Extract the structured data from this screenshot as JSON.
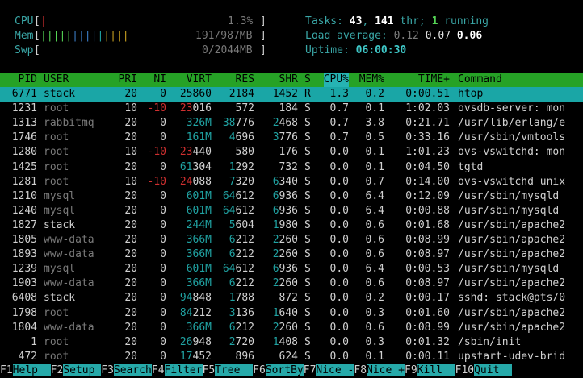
{
  "meters": {
    "cpu": {
      "label": "CPU",
      "bar": "|",
      "value": "1.3%"
    },
    "mem": {
      "label": "Mem",
      "bar": "||||||||||||||",
      "value": "191/987MB"
    },
    "swp": {
      "label": "Swp",
      "bar": "",
      "value": "0/2044MB"
    }
  },
  "summary": {
    "tasks_label": "Tasks: ",
    "tasks": "43",
    "thr": "141",
    "thr_label": " thr; ",
    "running": "1",
    "running_label": " running",
    "load_label": "Load average: ",
    "load1": "0.12",
    "load5": "0.07",
    "load15": "0.06",
    "uptime_label": "Uptime: ",
    "uptime": "06:00:30"
  },
  "columns": [
    "PID",
    "USER",
    "PRI",
    "NI",
    "VIRT",
    "RES",
    "SHR",
    "S",
    "CPU%",
    "MEM%",
    "TIME+",
    "Command"
  ],
  "processes": [
    {
      "pid": "6771",
      "user": "stack",
      "pri": "20",
      "ni": "0",
      "virt": "25860",
      "res": "2184",
      "shr": "1452",
      "s": "R",
      "cpu": "1.3",
      "mem": "0.2",
      "time": "0:00.51",
      "cmd": "htop",
      "selected": true
    },
    {
      "pid": "1231",
      "user": "root",
      "pri": "10",
      "ni": "-10",
      "virt": "23016",
      "res": "572",
      "shr": "184",
      "s": "S",
      "cpu": "0.7",
      "mem": "0.1",
      "time": "1:02.03",
      "cmd": "ovsdb-server: mon"
    },
    {
      "pid": "1313",
      "user": "rabbitmq",
      "pri": "20",
      "ni": "0",
      "virt": "326M",
      "res": "38776",
      "shr": "2468",
      "s": "S",
      "cpu": "0.7",
      "mem": "3.8",
      "time": "0:21.71",
      "cmd": "/usr/lib/erlang/e"
    },
    {
      "pid": "1746",
      "user": "root",
      "pri": "20",
      "ni": "0",
      "virt": "161M",
      "res": "4696",
      "shr": "3776",
      "s": "S",
      "cpu": "0.7",
      "mem": "0.5",
      "time": "0:33.16",
      "cmd": "/usr/sbin/vmtools"
    },
    {
      "pid": "1280",
      "user": "root",
      "pri": "10",
      "ni": "-10",
      "virt": "23440",
      "res": "580",
      "shr": "176",
      "s": "S",
      "cpu": "0.0",
      "mem": "0.1",
      "time": "1:01.23",
      "cmd": "ovs-vswitchd: mon"
    },
    {
      "pid": "1425",
      "user": "root",
      "pri": "20",
      "ni": "0",
      "virt": "61304",
      "res": "1292",
      "shr": "732",
      "s": "S",
      "cpu": "0.0",
      "mem": "0.1",
      "time": "0:04.50",
      "cmd": "tgtd"
    },
    {
      "pid": "1281",
      "user": "root",
      "pri": "10",
      "ni": "-10",
      "virt": "24088",
      "res": "7320",
      "shr": "6340",
      "s": "S",
      "cpu": "0.0",
      "mem": "0.7",
      "time": "0:14.00",
      "cmd": "ovs-vswitchd unix"
    },
    {
      "pid": "1210",
      "user": "mysql",
      "pri": "20",
      "ni": "0",
      "virt": "601M",
      "res": "64612",
      "shr": "6936",
      "s": "S",
      "cpu": "0.0",
      "mem": "6.4",
      "time": "0:12.09",
      "cmd": "/usr/sbin/mysqld"
    },
    {
      "pid": "1240",
      "user": "mysql",
      "pri": "20",
      "ni": "0",
      "virt": "601M",
      "res": "64612",
      "shr": "6936",
      "s": "S",
      "cpu": "0.0",
      "mem": "6.4",
      "time": "0:00.88",
      "cmd": "/usr/sbin/mysqld"
    },
    {
      "pid": "1827",
      "user": "stack",
      "pri": "20",
      "ni": "0",
      "virt": "244M",
      "res": "5604",
      "shr": "1980",
      "s": "S",
      "cpu": "0.0",
      "mem": "0.6",
      "time": "0:01.68",
      "cmd": "/usr/sbin/apache2"
    },
    {
      "pid": "1805",
      "user": "www-data",
      "pri": "20",
      "ni": "0",
      "virt": "366M",
      "res": "6212",
      "shr": "2260",
      "s": "S",
      "cpu": "0.0",
      "mem": "0.6",
      "time": "0:08.99",
      "cmd": "/usr/sbin/apache2"
    },
    {
      "pid": "1893",
      "user": "www-data",
      "pri": "20",
      "ni": "0",
      "virt": "366M",
      "res": "6212",
      "shr": "2260",
      "s": "S",
      "cpu": "0.0",
      "mem": "0.6",
      "time": "0:08.97",
      "cmd": "/usr/sbin/apache2"
    },
    {
      "pid": "1239",
      "user": "mysql",
      "pri": "20",
      "ni": "0",
      "virt": "601M",
      "res": "64612",
      "shr": "6936",
      "s": "S",
      "cpu": "0.0",
      "mem": "6.4",
      "time": "0:00.53",
      "cmd": "/usr/sbin/mysqld"
    },
    {
      "pid": "1903",
      "user": "www-data",
      "pri": "20",
      "ni": "0",
      "virt": "366M",
      "res": "6212",
      "shr": "2260",
      "s": "S",
      "cpu": "0.0",
      "mem": "0.6",
      "time": "0:08.97",
      "cmd": "/usr/sbin/apache2"
    },
    {
      "pid": "6408",
      "user": "stack",
      "pri": "20",
      "ni": "0",
      "virt": "94848",
      "res": "1788",
      "shr": "872",
      "s": "S",
      "cpu": "0.0",
      "mem": "0.2",
      "time": "0:00.17",
      "cmd": "sshd: stack@pts/0"
    },
    {
      "pid": "1798",
      "user": "root",
      "pri": "20",
      "ni": "0",
      "virt": "84212",
      "res": "3136",
      "shr": "1640",
      "s": "S",
      "cpu": "0.0",
      "mem": "0.3",
      "time": "0:01.60",
      "cmd": "/usr/sbin/apache2"
    },
    {
      "pid": "1804",
      "user": "www-data",
      "pri": "20",
      "ni": "0",
      "virt": "366M",
      "res": "6212",
      "shr": "2260",
      "s": "S",
      "cpu": "0.0",
      "mem": "0.6",
      "time": "0:08.99",
      "cmd": "/usr/sbin/apache2"
    },
    {
      "pid": "1",
      "user": "root",
      "pri": "20",
      "ni": "0",
      "virt": "26948",
      "res": "2720",
      "shr": "1408",
      "s": "S",
      "cpu": "0.0",
      "mem": "0.3",
      "time": "0:01.32",
      "cmd": "/sbin/init"
    },
    {
      "pid": "472",
      "user": "root",
      "pri": "20",
      "ni": "0",
      "virt": "17452",
      "res": "896",
      "shr": "624",
      "s": "S",
      "cpu": "0.0",
      "mem": "0.1",
      "time": "0:00.11",
      "cmd": "upstart-udev-brid"
    }
  ],
  "function_keys": [
    {
      "key": "F1",
      "label": "Help  "
    },
    {
      "key": "F2",
      "label": "Setup "
    },
    {
      "key": "F3",
      "label": "Search"
    },
    {
      "key": "F4",
      "label": "Filter"
    },
    {
      "key": "F5",
      "label": "Tree  "
    },
    {
      "key": "F6",
      "label": "SortBy"
    },
    {
      "key": "F7",
      "label": "Nice -"
    },
    {
      "key": "F8",
      "label": "Nice +"
    },
    {
      "key": "F9",
      "label": "Kill  "
    },
    {
      "key": "F10",
      "label": "Quit  "
    }
  ],
  "colors": {
    "header_bg": "#26a226",
    "sort_col_bg": "#26b3b3",
    "selected_bg": "#1aa6a6",
    "fkey_bg": "#26a9a9"
  }
}
